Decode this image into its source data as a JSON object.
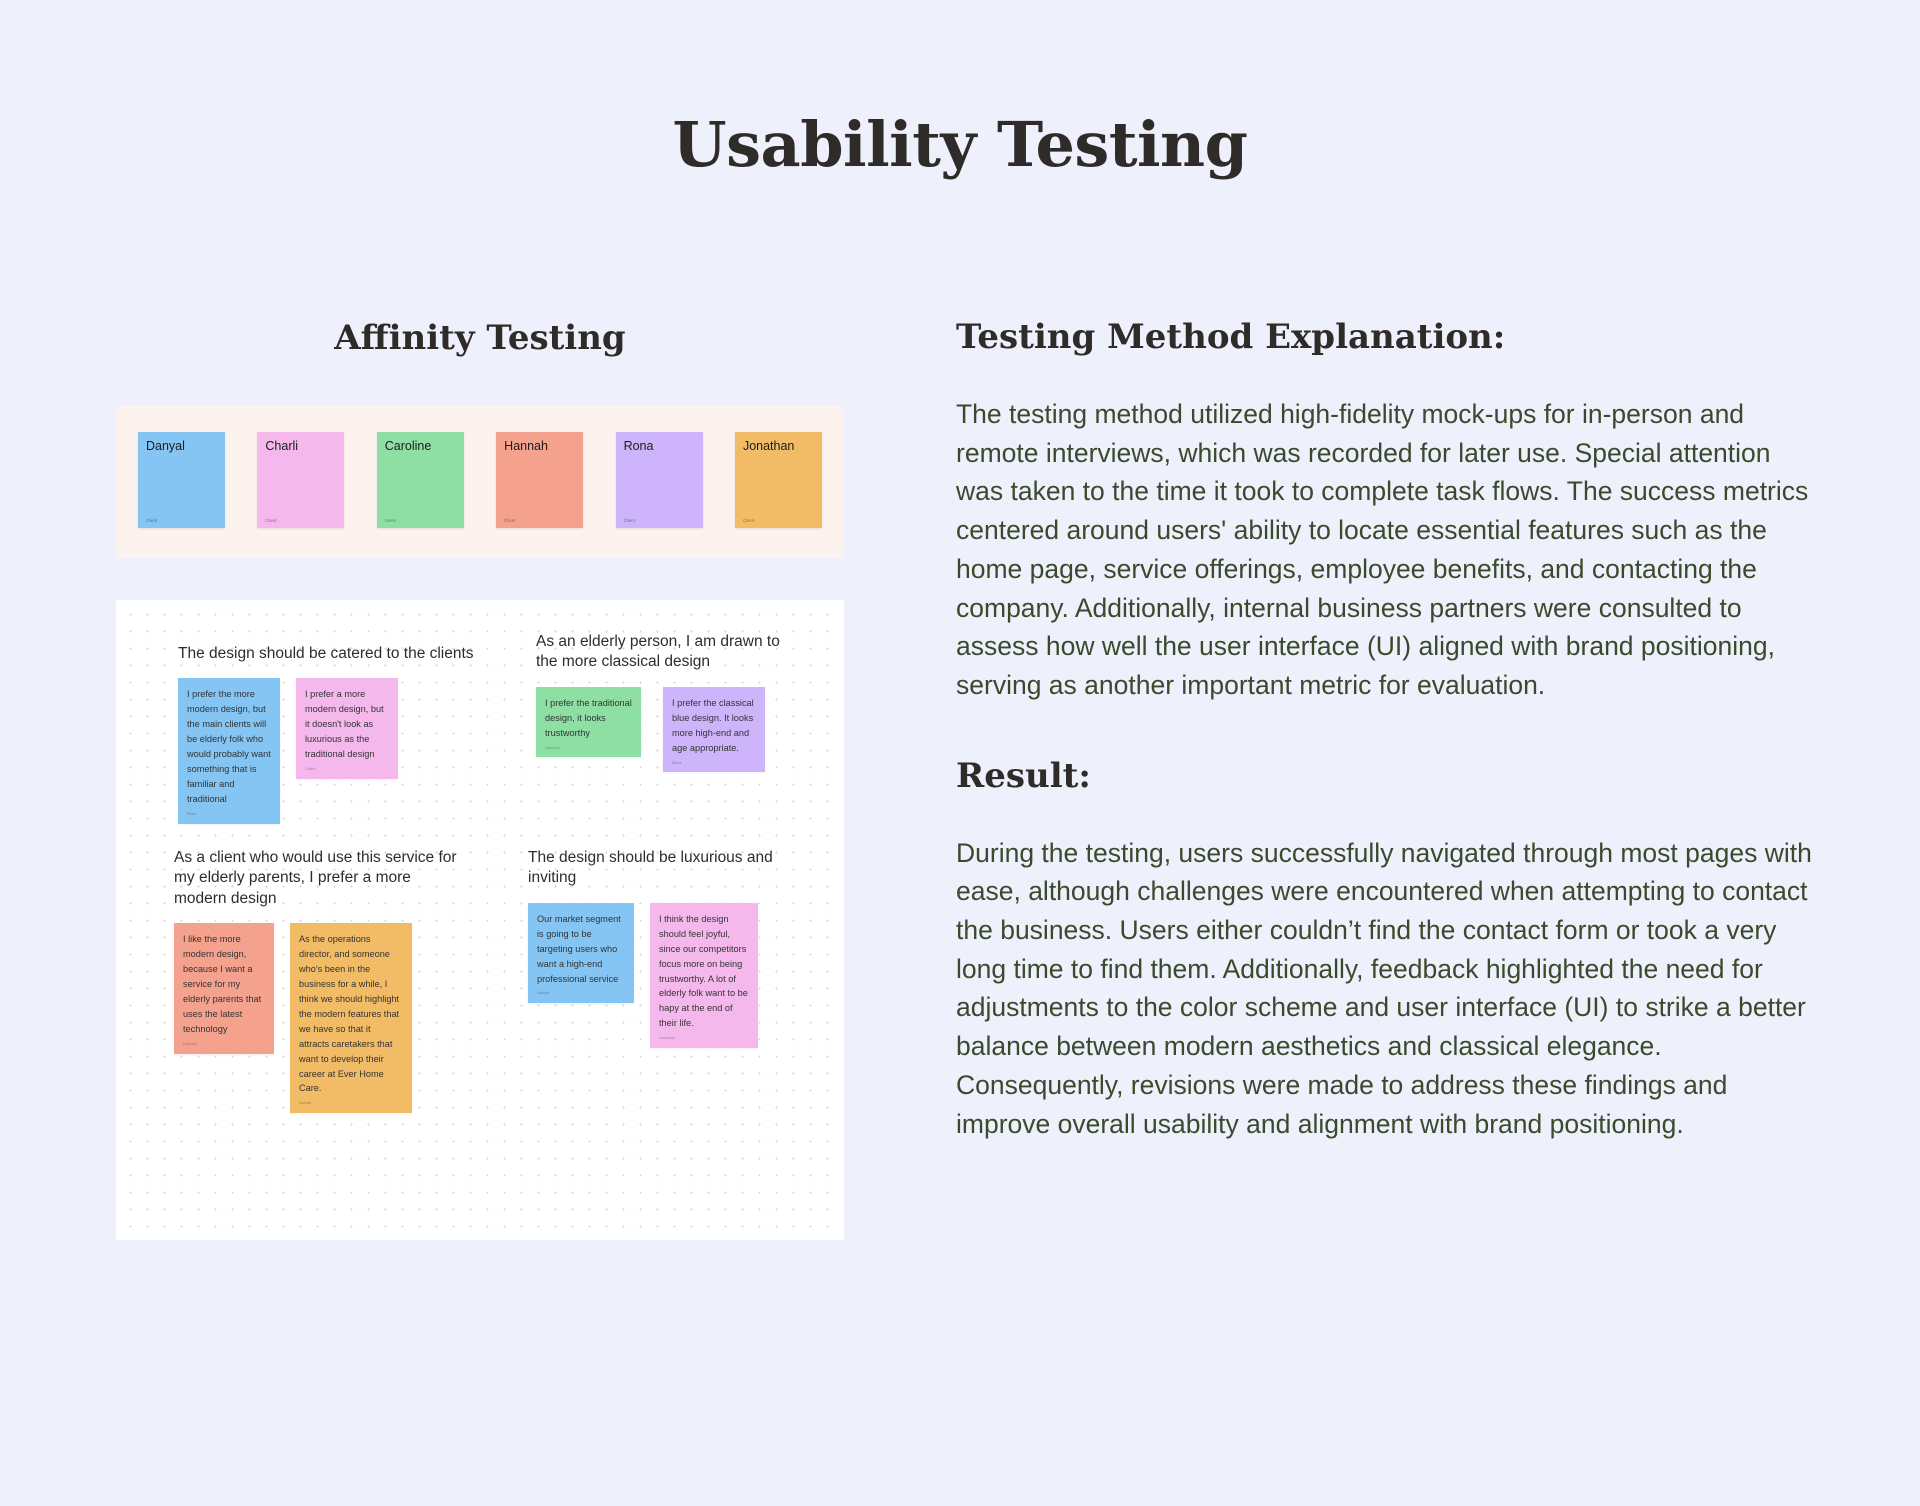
{
  "page": {
    "title": "Usability Testing",
    "background_color": "#eef0fc",
    "heading_color": "#2f2b28",
    "body_text_color": "#3b4a2c"
  },
  "left": {
    "section_title": "Affinity Testing",
    "participants_band": {
      "background_color": "#fdf3ee",
      "cards": [
        {
          "name": "Danyal",
          "meta": "Client",
          "color": "#84c5f4"
        },
        {
          "name": "Charli",
          "meta": "Client",
          "color": "#f5b8ec"
        },
        {
          "name": "Caroline",
          "meta": "Users",
          "color": "#8edfa4"
        },
        {
          "name": "Hannah",
          "meta": "Client",
          "color": "#f4a28e"
        },
        {
          "name": "Rona",
          "meta": "Client",
          "color": "#cdb4fb"
        },
        {
          "name": "Jonathan",
          "meta": "Client",
          "color": "#f2bc67"
        }
      ]
    },
    "board": {
      "background_color": "#ffffff",
      "clusters": [
        {
          "heading": "The design should be catered to the clients",
          "notes": [
            {
              "text": "I prefer the more modern design, but the main clients will be elderly folk who would probably want something that is familiar and traditional",
              "footer": "Rona",
              "color": "#84c5f4"
            },
            {
              "text": "I prefer a more modern design, but it doesn't look as luxurious as the traditional design",
              "footer": "Charli",
              "color": "#f5b8ec"
            }
          ]
        },
        {
          "heading": "As an elderly person, I am drawn to the more classical design",
          "notes": [
            {
              "text": "I prefer the traditional design, it looks trustworthy",
              "footer": "Caroline",
              "color": "#8edfa4"
            },
            {
              "text": "I prefer the classical blue design. It looks more high-end and age appropriate.",
              "footer": "Rona",
              "color": "#cdb4fb"
            }
          ]
        },
        {
          "heading": "As a client who would use this service for my elderly parents, I prefer a more modern design",
          "notes": [
            {
              "text": "I like the more modern design, because I want a service for my elderly parents that uses the latest technology",
              "footer": "Hannah",
              "color": "#f4a28e"
            },
            {
              "text": "As the operations director, and someone who's been in the business for a while, I think we should highlight the modern features that we have so that it attracts caretakers that want to develop their career at Ever Home Care.",
              "footer": "Danyal",
              "color": "#f2bc67"
            }
          ]
        },
        {
          "heading": "The design should be luxurious and inviting",
          "notes": [
            {
              "text": "Our market segment is going to be targeting users who want a high-end professional service",
              "footer": "Danyal",
              "color": "#84c5f4"
            },
            {
              "text": "I think the design should feel joyful, since our competitors focus more on being trustworthy. A lot of elderly folk want to be hapy at the end of their life.",
              "footer": "Jonathan",
              "color": "#f5b8ec"
            }
          ]
        }
      ]
    }
  },
  "right": {
    "method_heading": "Testing Method Explanation:",
    "method_body": "The testing method utilized high-fidelity mock-ups for in-person and remote interviews, which was recorded for later use. Special attention was taken to the time it took to complete task flows. The success metrics centered around users' ability to locate essential features such as the home page, service offerings, employee benefits, and contacting the company. Additionally, internal business partners were consulted to assess how well the user interface (UI) aligned with brand positioning, serving as another important metric for evaluation.",
    "result_heading": "Result:",
    "result_body": "During the testing, users successfully navigated through most pages with ease, although challenges were encountered when attempting to contact the business. Users either couldn’t find the contact form or took a very long time to find them. Additionally, feedback highlighted the need for adjustments to the color scheme and user interface (UI) to strike a better balance between modern aesthetics and classical elegance. Consequently, revisions were made to address these findings and improve overall usability and alignment with brand positioning."
  }
}
